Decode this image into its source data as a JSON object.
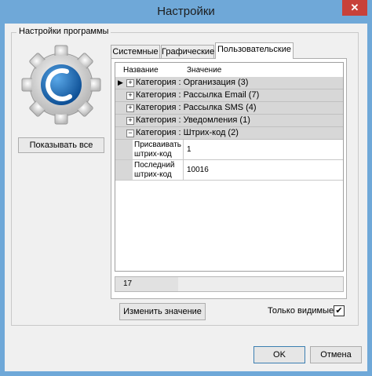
{
  "window": {
    "title": "Настройки",
    "close_glyph": "✕"
  },
  "group": {
    "title": "Настройки программы"
  },
  "left": {
    "show_all_label": "Показывать все",
    "logo_icon": "settings-gear-logo"
  },
  "tabs": [
    {
      "label": "Системные",
      "active": false
    },
    {
      "label": "Графические",
      "active": false
    },
    {
      "label": "Пользовательские",
      "active": true
    }
  ],
  "grid": {
    "columns": [
      "Название",
      "Значение"
    ],
    "categories": [
      {
        "label": "Категория : Организация (3)",
        "toggle": "+"
      },
      {
        "label": "Категория : Рассылка Email (7)",
        "toggle": "+"
      },
      {
        "label": "Категория : Рассылка SMS (4)",
        "toggle": "+"
      },
      {
        "label": "Категория : Уведомления (1)",
        "toggle": "+"
      },
      {
        "label": "Категория : Штрих-код (2)",
        "toggle": "−"
      }
    ],
    "rows": [
      {
        "name": "Присваивать штрих-код",
        "value": "1"
      },
      {
        "name": "Последний штрих-код",
        "value": "10016"
      }
    ],
    "status_count": "17"
  },
  "actions": {
    "change_value_label": "Изменить значение",
    "only_visible_label": "Только видимые",
    "only_visible_checked": "✔"
  },
  "footer": {
    "ok_label": "OK",
    "cancel_label": "Отмена"
  },
  "colors": {
    "frame": "#6fa8d8",
    "close": "#c8413a",
    "logo_blue": "#1d6fb8"
  }
}
